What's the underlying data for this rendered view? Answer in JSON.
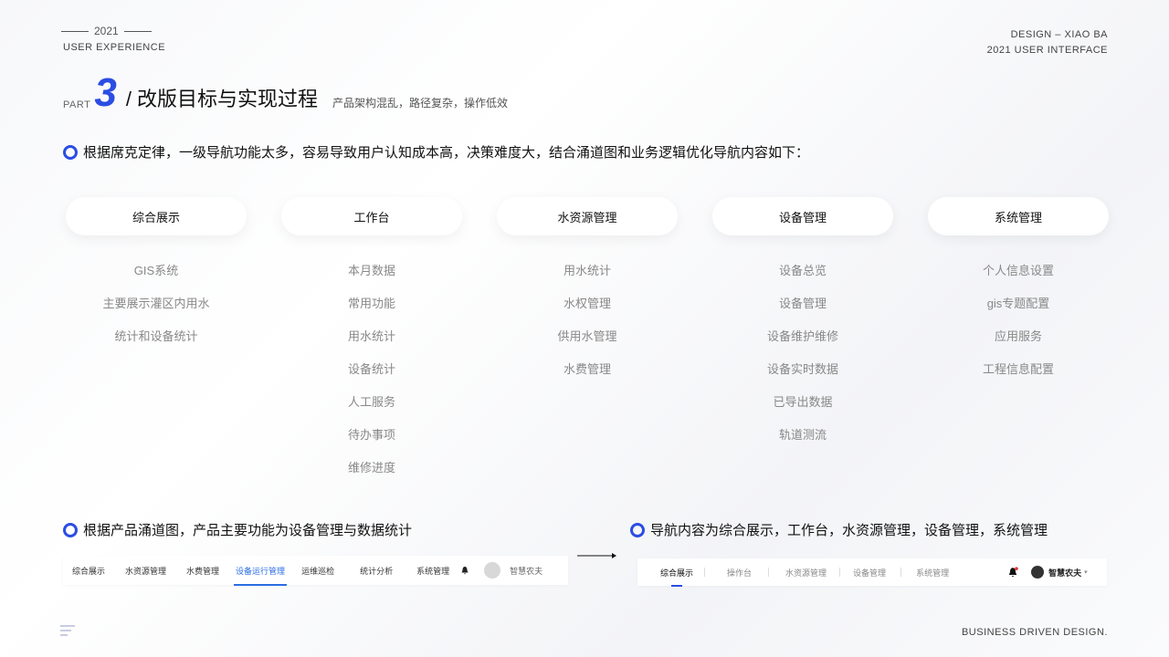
{
  "header": {
    "year": "2021",
    "left_caption": "USER EXPERIENCE",
    "right_line1": "DESIGN – XIAO BA",
    "right_line2": "2021 USER INTERFACE"
  },
  "part": {
    "word": "PART",
    "number": "3",
    "title": "/ 改版目标与实现过程",
    "subtitle": "产品架构混乱，路径复杂，操作低效"
  },
  "intro": "根据席克定律，一级导航功能太多，容易导致用户认知成本高，决策难度大，结合涌道图和业务逻辑优化导航内容如下：",
  "columns": [
    {
      "title": "综合展示",
      "items": [
        "GIS系统",
        "主要展示灌区内用水",
        "统计和设备统计"
      ]
    },
    {
      "title": "工作台",
      "items": [
        "本月数据",
        "常用功能",
        "用水统计",
        "设备统计",
        "人工服务",
        "待办事项",
        "维修进度"
      ]
    },
    {
      "title": "水资源管理",
      "items": [
        "用水统计",
        "水权管理",
        "供用水管理",
        "水费管理"
      ]
    },
    {
      "title": "设备管理",
      "items": [
        "设备总览",
        "设备管理",
        "设备维护维修",
        "设备实时数据",
        "已导出数据",
        "轨道测流"
      ]
    },
    {
      "title": "系统管理",
      "items": [
        "个人信息设置",
        "gis专题配置",
        "应用服务",
        "工程信息配置"
      ]
    }
  ],
  "bottom_left": {
    "caption": "根据产品涌道图，产品主要功能为设备管理与数据统计",
    "nav": [
      "综合展示",
      "水资源管理",
      "水费管理",
      "设备运行管理",
      "运维巡检",
      "统计分析",
      "系统管理"
    ],
    "active_index": 3,
    "user": "智慧农夫"
  },
  "bottom_right": {
    "caption": "导航内容为综合展示，工作台，水资源管理，设备管理，系统管理",
    "nav": [
      "综合展示",
      "操作台",
      "水资源管理",
      "设备管理",
      "系统管理"
    ],
    "active_index": 0,
    "user": "智慧农夫"
  },
  "footer": {
    "right": "BUSINESS DRIVEN DESIGN."
  },
  "colors": {
    "accent": "#2b4de3",
    "nav_active": "#2b6de3"
  }
}
